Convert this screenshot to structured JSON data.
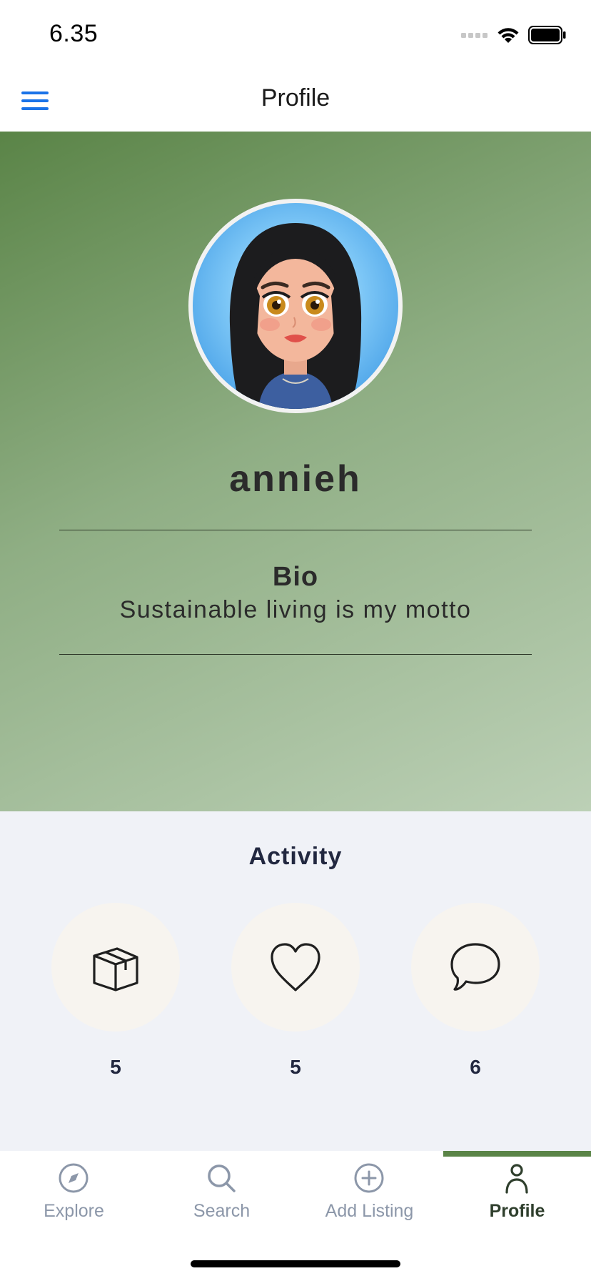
{
  "status_bar": {
    "time": "6.35"
  },
  "nav": {
    "title": "Profile",
    "menu_icon": "hamburger-menu-icon"
  },
  "profile": {
    "username": "annieh",
    "bio_title": "Bio",
    "bio_text": "Sustainable living is my motto"
  },
  "activity": {
    "title": "Activity",
    "stats": [
      {
        "icon": "box-icon",
        "count": "5"
      },
      {
        "icon": "heart-icon",
        "count": "5"
      },
      {
        "icon": "chat-bubble-icon",
        "count": "6"
      }
    ]
  },
  "tabs": [
    {
      "label": "Explore",
      "icon": "compass-icon"
    },
    {
      "label": "Search",
      "icon": "search-icon"
    },
    {
      "label": "Add Listing",
      "icon": "plus-circle-icon"
    },
    {
      "label": "Profile",
      "icon": "person-icon",
      "active": true
    }
  ],
  "colors": {
    "accent": "#5a8447",
    "nav_blue": "#1a73e8",
    "tab_inactive": "#8c97a9",
    "activity_bg": "#f0f2f7"
  }
}
